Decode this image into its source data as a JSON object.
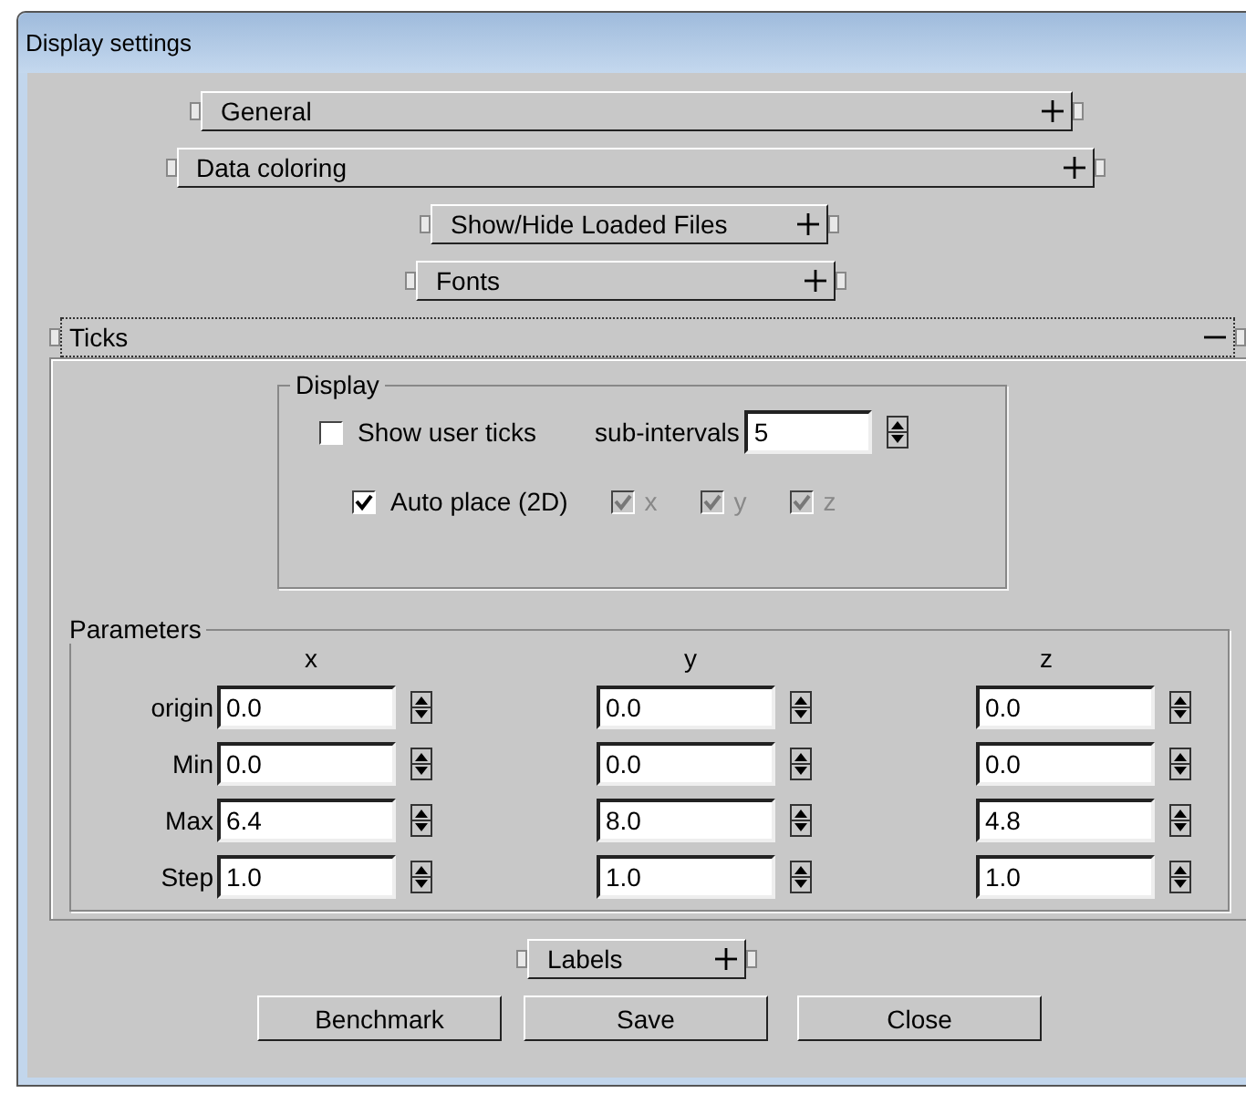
{
  "window": {
    "title": "Display settings"
  },
  "sections": [
    {
      "label": "General",
      "expanded": false
    },
    {
      "label": "Data coloring",
      "expanded": false
    },
    {
      "label": "Show/Hide Loaded Files",
      "expanded": false
    },
    {
      "label": "Fonts",
      "expanded": false
    },
    {
      "label": "Ticks",
      "expanded": true
    },
    {
      "label": "Labels",
      "expanded": false
    }
  ],
  "ticks": {
    "display": {
      "title": "Display",
      "show_user_ticks": {
        "label": "Show user ticks",
        "checked": false
      },
      "sub_intervals": {
        "label": "sub-intervals",
        "value": "5"
      },
      "auto_place": {
        "label": "Auto place (2D)",
        "checked": true
      },
      "axes": [
        {
          "label": "x",
          "checked": true,
          "disabled": true
        },
        {
          "label": "y",
          "checked": true,
          "disabled": true
        },
        {
          "label": "z",
          "checked": true,
          "disabled": true
        }
      ]
    },
    "parameters": {
      "title": "Parameters",
      "columns": [
        "x",
        "y",
        "z"
      ],
      "rows": [
        {
          "label": "origin",
          "values": [
            "0.0",
            "0.0",
            "0.0"
          ]
        },
        {
          "label": "Min",
          "values": [
            "0.0",
            "0.0",
            "0.0"
          ]
        },
        {
          "label": "Max",
          "values": [
            "6.4",
            "8.0",
            "4.8"
          ]
        },
        {
          "label": "Step",
          "values": [
            "1.0",
            "1.0",
            "1.0"
          ]
        }
      ]
    }
  },
  "buttons": [
    "Benchmark",
    "Save",
    "Close"
  ]
}
